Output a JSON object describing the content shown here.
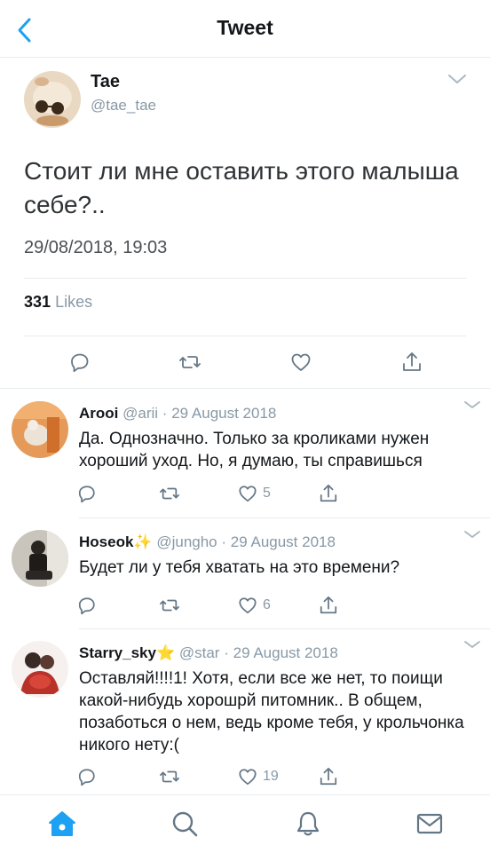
{
  "header": {
    "title": "Tweet",
    "back_icon": "chevron-left-icon"
  },
  "colors": {
    "accent": "#1da1f2",
    "muted": "#8899a6",
    "text": "#14171a"
  },
  "main_tweet": {
    "author_name": "Tae",
    "author_handle": "@tae_tae",
    "text": "Стоит ли мне оставить этого малыша себе?..",
    "timestamp": "29/08/2018, 19:03",
    "likes_count": "331",
    "likes_label": "Likes"
  },
  "replies": [
    {
      "name": "Arooi",
      "emoji": "",
      "handle": "@arii",
      "sep": "·",
      "date": "29 August 2018",
      "text": "Да. Однозначно. Только за кроликами нужен хороший уход. Но, я думаю, ты справишься",
      "likes": "5"
    },
    {
      "name": "Hoseok",
      "emoji": "✨",
      "handle": "@jungho",
      "sep": "·",
      "date": "29 August 2018",
      "text": "Будет ли у тебя хватать на это времени?",
      "likes": "6"
    },
    {
      "name": "Starry_sky",
      "emoji": "⭐",
      "handle": "@star",
      "sep": "·",
      "date": "29 August 2018",
      "text": "Оставляй!!!!1! Хотя, если все же нет, то поищи какой-нибудь хорошрй питомник.. В общем, позаботься о нем, ведь кроме тебя, у крольчонка никого нету:(",
      "likes": "19"
    }
  ],
  "tabs": [
    "home-icon",
    "search-icon",
    "bell-icon",
    "mail-icon"
  ]
}
